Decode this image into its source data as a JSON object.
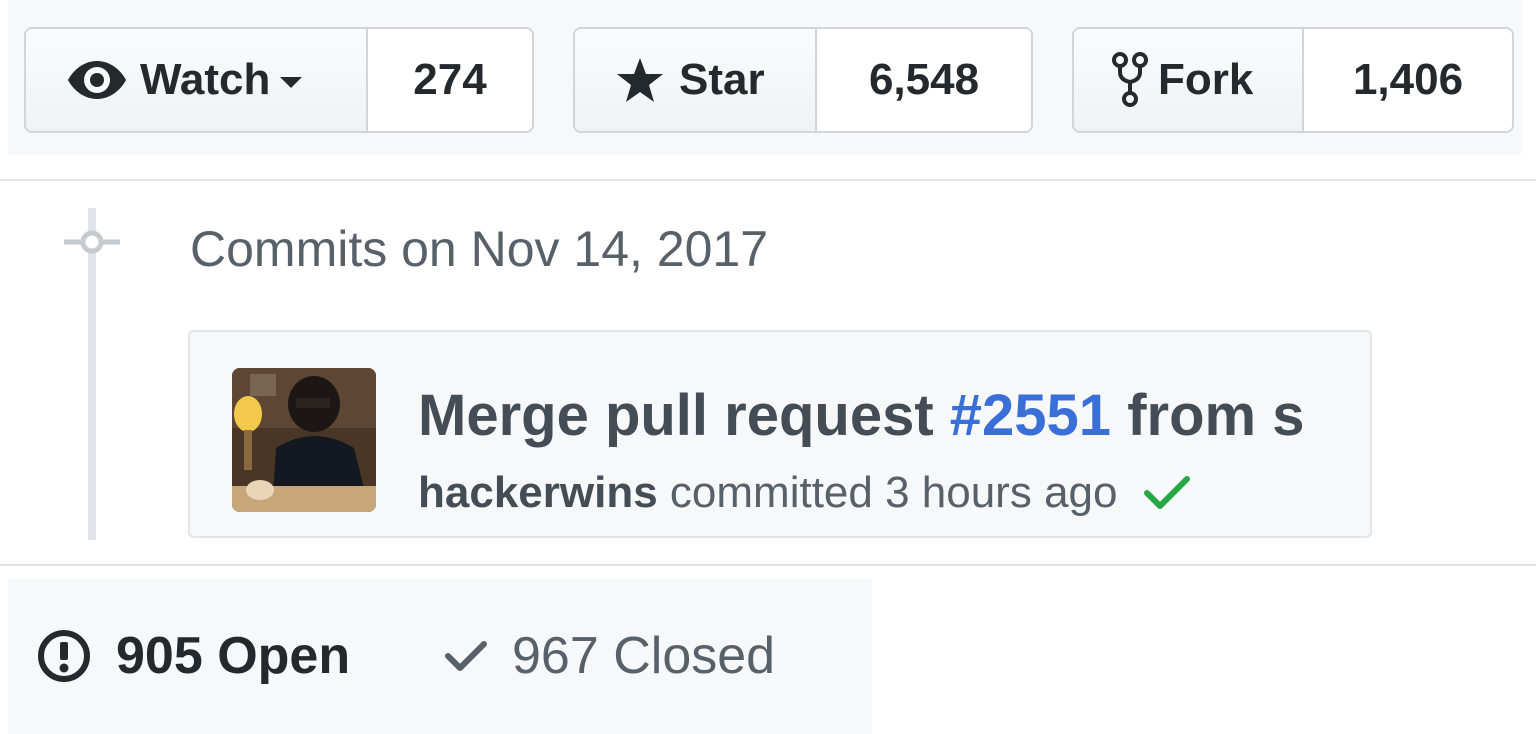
{
  "social": {
    "watch": {
      "label": "Watch",
      "count": "274",
      "icon": "eye-icon"
    },
    "star": {
      "label": "Star",
      "count": "6,548",
      "icon": "star-icon"
    },
    "fork": {
      "label": "Fork",
      "count": "1,406",
      "icon": "fork-icon"
    }
  },
  "commits": {
    "heading": "Commits on Nov 14, 2017",
    "commit": {
      "title_prefix": "Merge pull request ",
      "pr_number": "#2551",
      "title_suffix": " from s",
      "author": "hackerwins",
      "meta_text": " committed 3 hours ago",
      "status": "success"
    }
  },
  "issues": {
    "open_label": "905 Open",
    "closed_label": "967 Closed"
  },
  "colors": {
    "link": "#3b6fd8",
    "success": "#28a745",
    "text": "#24292e",
    "muted": "#586069"
  }
}
